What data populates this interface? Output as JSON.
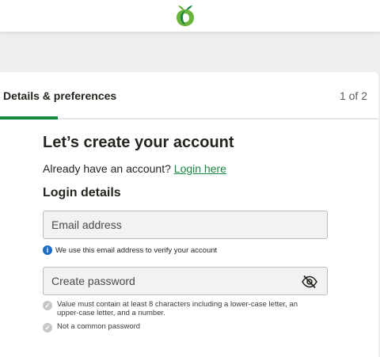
{
  "header": {
    "logo_icon": "woolworths-apple-logo",
    "brand_color": "#178841"
  },
  "progress": {
    "step_title": "Details & preferences",
    "step_count": "1 of 2",
    "fraction_complete": 0.15
  },
  "form": {
    "heading": "Let’s create your account",
    "already_text": "Already have an account?",
    "login_link": "Login here",
    "section_title": "Login details",
    "email": {
      "placeholder": "Email address",
      "value": "",
      "hint": "We use this email address to verify your account",
      "hint_icon": "info-icon"
    },
    "password": {
      "placeholder": "Create password",
      "value": "",
      "toggle_icon": "eye-slash-icon"
    },
    "rules": [
      {
        "icon": "check-circle-icon",
        "text": "Value must contain at least 8 characters including a lower-case letter, an upper-case letter, and a number."
      },
      {
        "icon": "check-circle-icon",
        "text": "Not a common password"
      }
    ]
  }
}
